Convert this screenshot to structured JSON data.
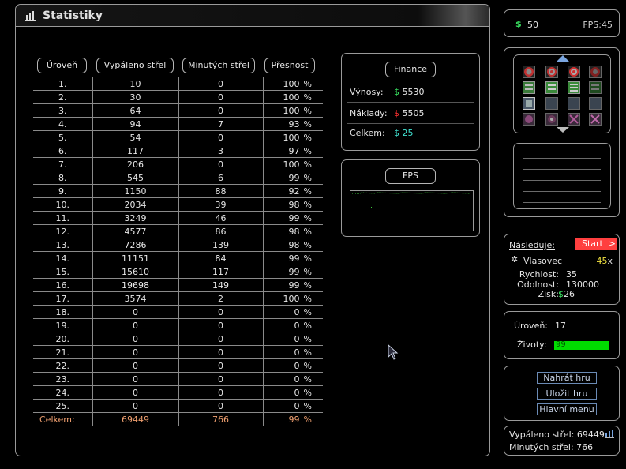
{
  "title": "Statistiky",
  "table": {
    "headers": [
      "Úroveň",
      "Vypáleno střel",
      "Minutých střel",
      "Přesnost"
    ],
    "rows": [
      {
        "level": "1.",
        "fired": "10",
        "missed": "0",
        "acc": "100"
      },
      {
        "level": "2.",
        "fired": "30",
        "missed": "0",
        "acc": "100"
      },
      {
        "level": "3.",
        "fired": "64",
        "missed": "0",
        "acc": "100"
      },
      {
        "level": "4.",
        "fired": "94",
        "missed": "7",
        "acc": "93"
      },
      {
        "level": "5.",
        "fired": "54",
        "missed": "0",
        "acc": "100"
      },
      {
        "level": "6.",
        "fired": "117",
        "missed": "3",
        "acc": "97"
      },
      {
        "level": "7.",
        "fired": "206",
        "missed": "0",
        "acc": "100"
      },
      {
        "level": "8.",
        "fired": "545",
        "missed": "6",
        "acc": "99"
      },
      {
        "level": "9.",
        "fired": "1150",
        "missed": "88",
        "acc": "92"
      },
      {
        "level": "10.",
        "fired": "2034",
        "missed": "39",
        "acc": "98"
      },
      {
        "level": "11.",
        "fired": "3249",
        "missed": "46",
        "acc": "99"
      },
      {
        "level": "12.",
        "fired": "4577",
        "missed": "86",
        "acc": "98"
      },
      {
        "level": "13.",
        "fired": "7286",
        "missed": "139",
        "acc": "98"
      },
      {
        "level": "14.",
        "fired": "11151",
        "missed": "84",
        "acc": "99"
      },
      {
        "level": "15.",
        "fired": "15610",
        "missed": "117",
        "acc": "99"
      },
      {
        "level": "16.",
        "fired": "19698",
        "missed": "149",
        "acc": "99"
      },
      {
        "level": "17.",
        "fired": "3574",
        "missed": "2",
        "acc": "100"
      },
      {
        "level": "18.",
        "fired": "0",
        "missed": "0",
        "acc": "0"
      },
      {
        "level": "19.",
        "fired": "0",
        "missed": "0",
        "acc": "0"
      },
      {
        "level": "20.",
        "fired": "0",
        "missed": "0",
        "acc": "0"
      },
      {
        "level": "21.",
        "fired": "0",
        "missed": "0",
        "acc": "0"
      },
      {
        "level": "22.",
        "fired": "0",
        "missed": "0",
        "acc": "0"
      },
      {
        "level": "23.",
        "fired": "0",
        "missed": "0",
        "acc": "0"
      },
      {
        "level": "24.",
        "fired": "0",
        "missed": "0",
        "acc": "0"
      },
      {
        "level": "25.",
        "fired": "0",
        "missed": "0",
        "acc": "0"
      }
    ],
    "pct_sign": "%",
    "total": {
      "label": "Celkem:",
      "fired": "69449",
      "missed": "766",
      "acc": "99"
    }
  },
  "finance": {
    "button": "Finance",
    "currency": "$",
    "income_label": "Výnosy:",
    "income": "5530",
    "costs_label": "Náklady:",
    "costs": "5505",
    "total_label": "Celkem:",
    "total": "25"
  },
  "fps_panel": {
    "button": "FPS"
  },
  "top_bar": {
    "currency": "$",
    "money": "50",
    "fps": "FPS:45"
  },
  "next_wave": {
    "label": "Následuje:",
    "start": "Start",
    "start_arrow": ">",
    "enemy": "Vlasovec",
    "count": "45",
    "count_x": "x",
    "speed_label": "Rychlost:",
    "speed": "35",
    "toughness_label": "Odolnost:",
    "toughness": "130000",
    "reward_label": "Zisk:",
    "reward_currency": "$",
    "reward": "26"
  },
  "status": {
    "level_label": "Úroveň:",
    "level": "17",
    "lives_label": "Životy:",
    "lives": "99"
  },
  "menu": {
    "load": "Nahrát hru",
    "save": "Uložit hru",
    "main": "Hlavní menu"
  },
  "summary": {
    "fired": "Vypáleno střel: 69449",
    "missed": "Minutých střel: 766"
  },
  "colors": {
    "money_green": "#39e060",
    "cost_red": "#ff3030",
    "total_cyan": "#40e0d0",
    "lives_green": "#00dd00",
    "start_red": "#ff3f3f",
    "total_row": "#f0a070"
  }
}
